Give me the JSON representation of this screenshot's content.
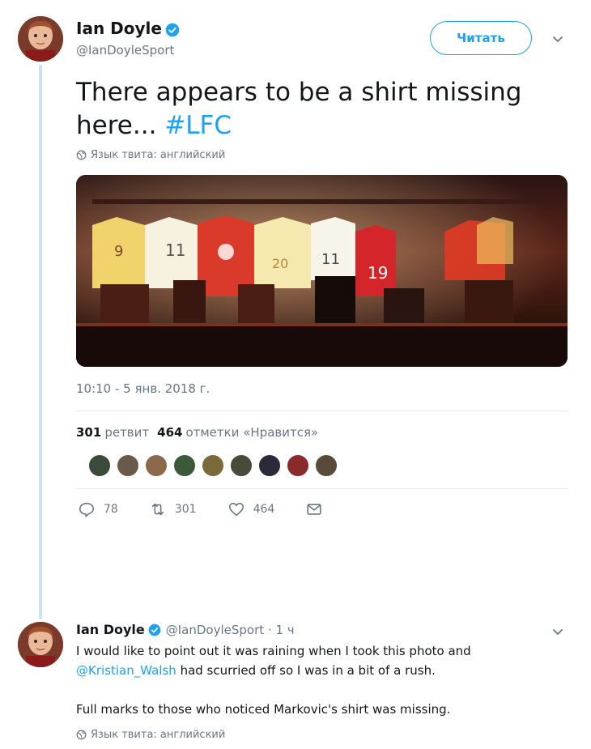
{
  "tweet": {
    "author_name": "Ian Doyle",
    "author_handle": "@IanDoyleSport",
    "follow_label": "Читать",
    "text_main": "There appears to be a shirt missing here... ",
    "hashtag": "#LFC",
    "lang_label": "Язык твита: английский",
    "photo_jersey_numbers": [
      "9",
      "11",
      "20",
      "11",
      "19"
    ],
    "timestamp": "10:10 - 5 янв. 2018 г.",
    "retweets_count": "301",
    "retweets_label": "ретвит",
    "likes_count": "464",
    "likes_label": "отметки «Нравится»",
    "actions": {
      "reply_count": "78",
      "retweet_count": "301",
      "like_count": "464"
    }
  },
  "reply": {
    "author_name": "Ian Doyle",
    "author_handle": "@IanDoyleSport",
    "time": "· 1 ч",
    "line1": "I would like to point out it was raining when I took this photo and",
    "mention": "@Kristian_Walsh",
    "line2_rest": " had scurried off so I was in a bit of a rush.",
    "line3": "Full marks to those who noticed Markovic's shirt was missing.",
    "lang_label": "Язык твита: английский"
  },
  "colors": {
    "accent": "#1da1f2",
    "muted": "#657786",
    "thread_line": "#c8e2f7"
  }
}
